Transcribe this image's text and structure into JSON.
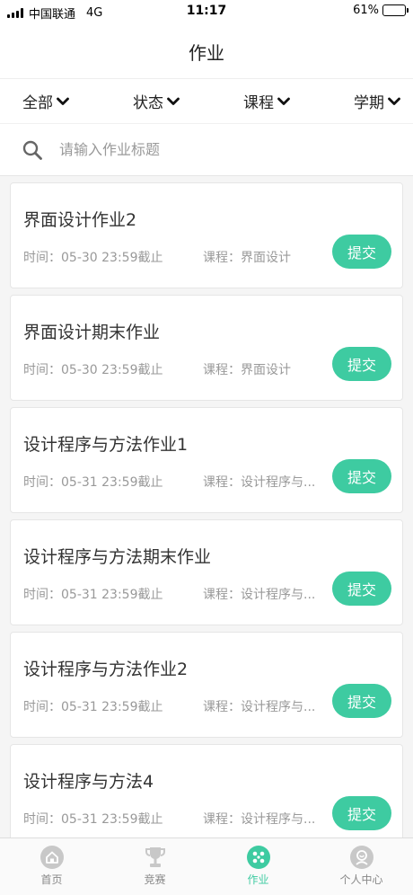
{
  "status_bar": {
    "carrier": "中国联通",
    "network": "4G",
    "time": "11:17",
    "battery": "61%",
    "battery_level": 0.61
  },
  "nav": {
    "title": "作业"
  },
  "filters": [
    {
      "label": "全部"
    },
    {
      "label": "状态"
    },
    {
      "label": "课程"
    },
    {
      "label": "学期"
    }
  ],
  "search": {
    "placeholder": "请输入作业标题",
    "value": ""
  },
  "assignments": [
    {
      "title": "界面设计作业2",
      "time": "时间：05-30 23:59截止",
      "course": "课程：界面设计",
      "action": "提交"
    },
    {
      "title": "界面设计期末作业",
      "time": "时间：05-30 23:59截止",
      "course": "课程：界面设计",
      "action": "提交"
    },
    {
      "title": "设计程序与方法作业1",
      "time": "时间：05-31 23:59截止",
      "course": "课程：设计程序与...",
      "action": "提交"
    },
    {
      "title": "设计程序与方法期末作业",
      "time": "时间：05-31 23:59截止",
      "course": "课程：设计程序与...",
      "action": "提交"
    },
    {
      "title": "设计程序与方法作业2",
      "time": "时间：05-31 23:59截止",
      "course": "课程：设计程序与...",
      "action": "提交"
    },
    {
      "title": "设计程序与方法4",
      "time": "时间：05-31 23:59截止",
      "course": "课程：设计程序与...",
      "action": "提交"
    }
  ],
  "tabs": [
    {
      "label": "首页",
      "icon": "home-icon",
      "active": false
    },
    {
      "label": "竞赛",
      "icon": "trophy-icon",
      "active": false
    },
    {
      "label": "作业",
      "icon": "assignment-icon",
      "active": true
    },
    {
      "label": "个人中心",
      "icon": "profile-icon",
      "active": false
    }
  ],
  "colors": {
    "accent": "#3ecba1",
    "inactive_icon": "#c8c8c8"
  }
}
